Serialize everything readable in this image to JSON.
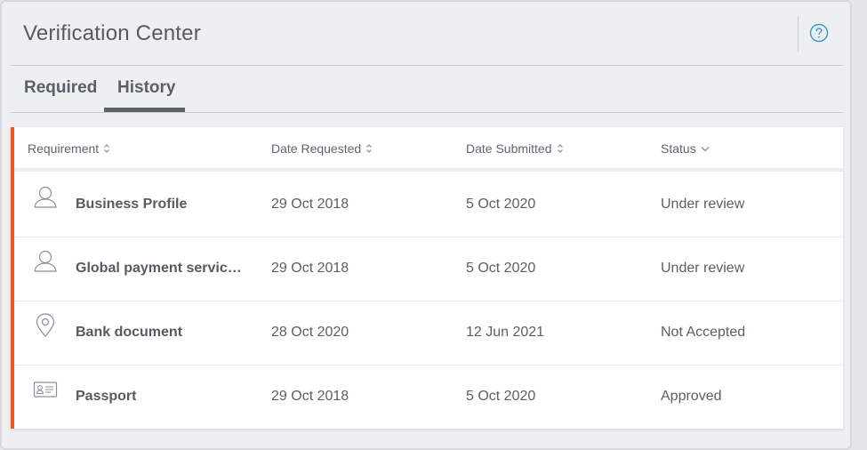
{
  "header": {
    "title": "Verification Center",
    "help_icon": "question-circle-icon"
  },
  "tabs": [
    {
      "label": "Required",
      "active": false
    },
    {
      "label": "History",
      "active": true
    }
  ],
  "table": {
    "columns": [
      {
        "label": "Requirement",
        "sort_icon": "sort-icon"
      },
      {
        "label": "Date Requested",
        "sort_icon": "sort-icon"
      },
      {
        "label": "Date Submitted",
        "sort_icon": "sort-icon"
      },
      {
        "label": "Status",
        "sort_icon": "chevron-down-icon"
      }
    ],
    "rows": [
      {
        "icon": "user-icon",
        "name": "Business Profile",
        "date_requested": "29 Oct 2018",
        "date_submitted": "5 Oct 2020",
        "status": "Under review"
      },
      {
        "icon": "user-icon",
        "name": "Global payment service qu…",
        "date_requested": "29 Oct 2018",
        "date_submitted": "5 Oct 2020",
        "status": "Under review"
      },
      {
        "icon": "location-pin-icon",
        "name": "Bank document",
        "date_requested": "28 Oct 2020",
        "date_submitted": "12 Jun 2021",
        "status": "Not Accepted"
      },
      {
        "icon": "id-card-icon",
        "name": "Passport",
        "date_requested": "29 Oct 2018",
        "date_submitted": "5 Oct 2020",
        "status": "Approved"
      }
    ]
  },
  "colors": {
    "accent": "#ee5a1b",
    "help_icon": "#2e9bd6",
    "text": "#5a6068"
  }
}
